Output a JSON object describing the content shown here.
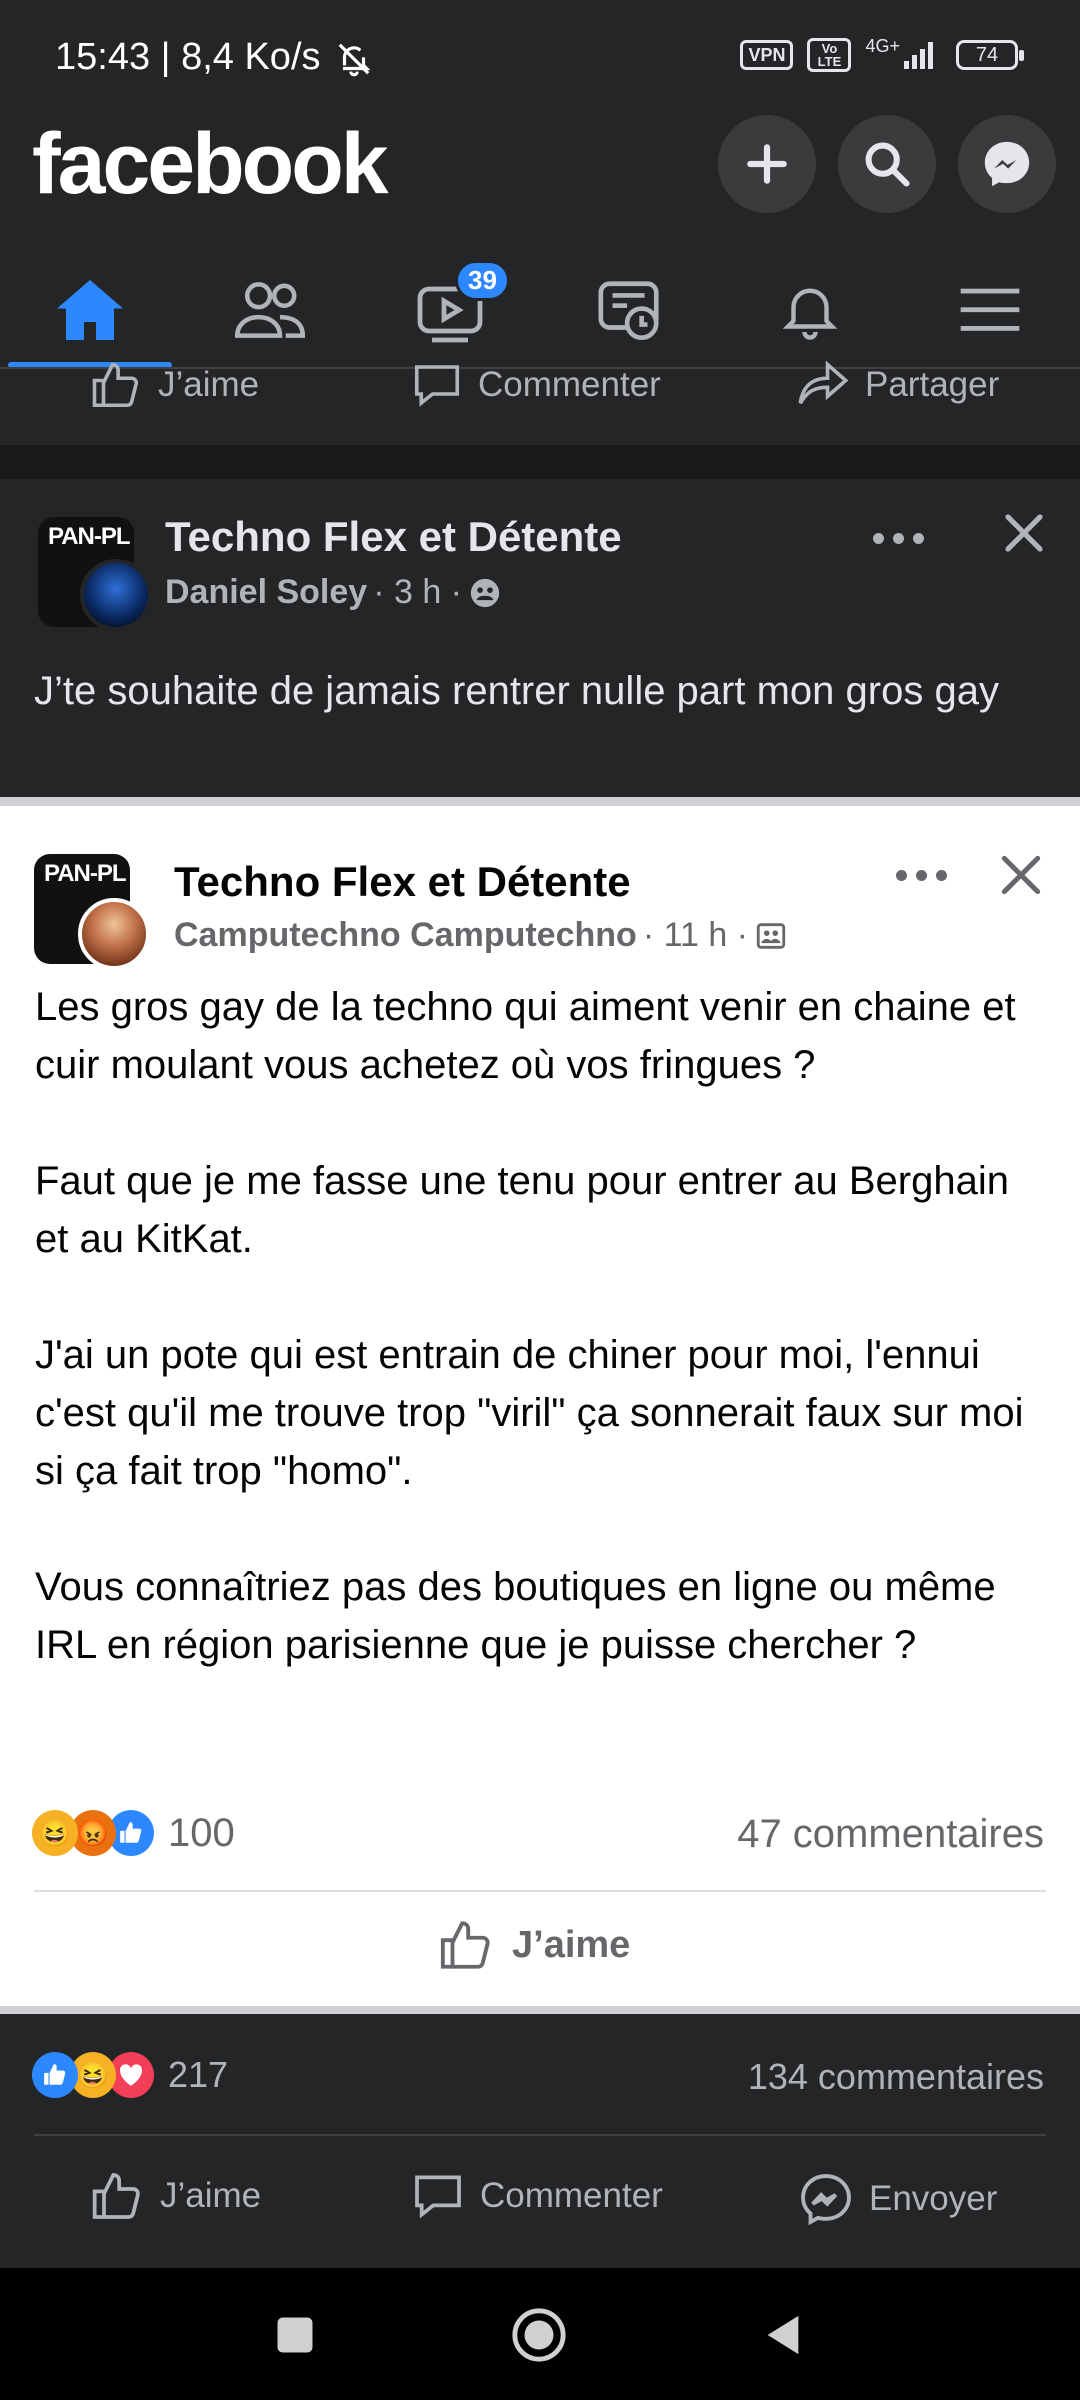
{
  "status": {
    "time": "15:43 | 8,4 Ko/s",
    "vpn": "VPN",
    "volte": "Vo LTE",
    "network": "4G+",
    "battery": "74"
  },
  "header": {
    "logo": "facebook"
  },
  "nav": {
    "videos_badge": "39"
  },
  "top_actions": {
    "like": "J’aime",
    "comment": "Commenter",
    "share": "Partager"
  },
  "post1": {
    "group": "Techno Flex et Détente",
    "avatar_text": "PAN-PL",
    "author": "Daniel Soley",
    "time": " · 3 h · ",
    "text": "J’te souhaite de jamais rentrer nulle part mon gros gay"
  },
  "shared": {
    "group": "Techno Flex et Détente",
    "avatar_text": "PAN-PL",
    "author": "Camputechno Camputechno",
    "time": " · 11 h · ",
    "text": "Les gros gay de la techno qui aiment venir en chaine et cuir moulant vous achetez où vos fringues ?\n\nFaut que je me fasse une tenu pour entrer au Berghain et au KitKat.\n\nJ'ai un pote qui est entrain de chiner pour moi, l'ennui c'est qu'il me trouve trop \"viril\" ça sonnerait faux sur moi si ça fait trop \"homo\".\n\nVous connaîtriez pas des boutiques en ligne ou même IRL en région parisienne que je puisse chercher ?",
    "reaction_count": "100",
    "comments": "47 commentaires",
    "like": "J’aime"
  },
  "bottom": {
    "reaction_count": "217",
    "comments": "134 commentaires",
    "like": "J’aime",
    "comment": "Commenter",
    "send": "Envoyer"
  },
  "colors": {
    "accent": "#2d88ff",
    "dark_bg": "#242526",
    "separator": "#18191a"
  }
}
